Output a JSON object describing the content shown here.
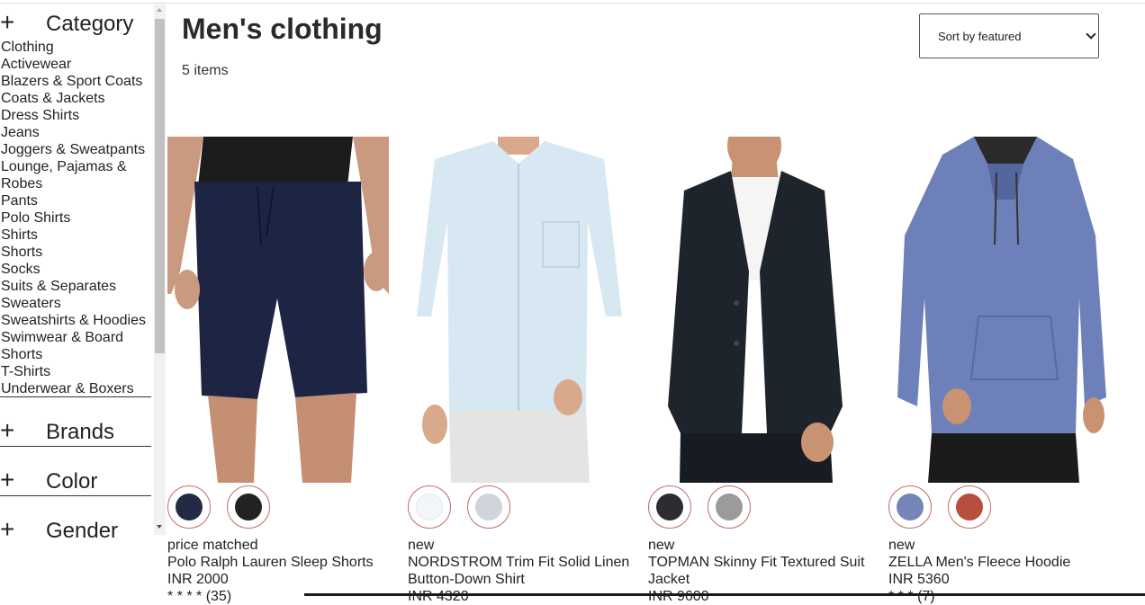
{
  "sidebar": {
    "category": {
      "icon": "plus-icon",
      "title": "Category",
      "items": [
        "Clothing",
        "Activewear",
        "Blazers & Sport Coats",
        "Coats & Jackets",
        "Dress Shirts",
        "Jeans",
        "Joggers & Sweatpants",
        "Lounge, Pajamas &",
        "Robes",
        "Pants",
        "Polo Shirts",
        "Shirts",
        "Shorts",
        "Socks",
        "Suits & Separates",
        "Sweaters",
        "Sweatshirts & Hoodies",
        "Swimwear & Board",
        "Shorts",
        "T-Shirts",
        "Underwear & Boxers"
      ]
    },
    "brands": {
      "icon": "plus-icon",
      "title": "Brands"
    },
    "color": {
      "icon": "plus-icon",
      "title": "Color"
    },
    "gender": {
      "icon": "plus-icon",
      "title": "Gender"
    }
  },
  "main": {
    "title": "Men's clothing",
    "count": "5 items",
    "sort": {
      "selected": "Sort by featured"
    }
  },
  "products": [
    {
      "tag": "price matched",
      "name": "Polo Ralph Lauren Sleep Shorts",
      "name2": "",
      "price": "INR 2000",
      "rating": "* * * * (35)",
      "swatches": [
        "#222b43",
        "#222222"
      ]
    },
    {
      "tag": "new",
      "name": "NORDSTROM Trim Fit Solid Linen",
      "name2": "Button-Down Shirt",
      "price": "INR 4320",
      "rating": "",
      "swatches": [
        "#f2f6f8",
        "#d0d4dd"
      ]
    },
    {
      "tag": "new",
      "name": "TOPMAN Skinny Fit Textured Suit",
      "name2": "Jacket",
      "price": "INR 9600",
      "rating": "",
      "swatches": [
        "#2b2d31",
        "#9b9b9b"
      ]
    },
    {
      "tag": "new",
      "name": "ZELLA Men's Fleece Hoodie",
      "name2": "",
      "price": "INR 5360",
      "rating": "* * * (7)",
      "swatches": [
        "#7585b7",
        "#b84e3d"
      ]
    }
  ]
}
